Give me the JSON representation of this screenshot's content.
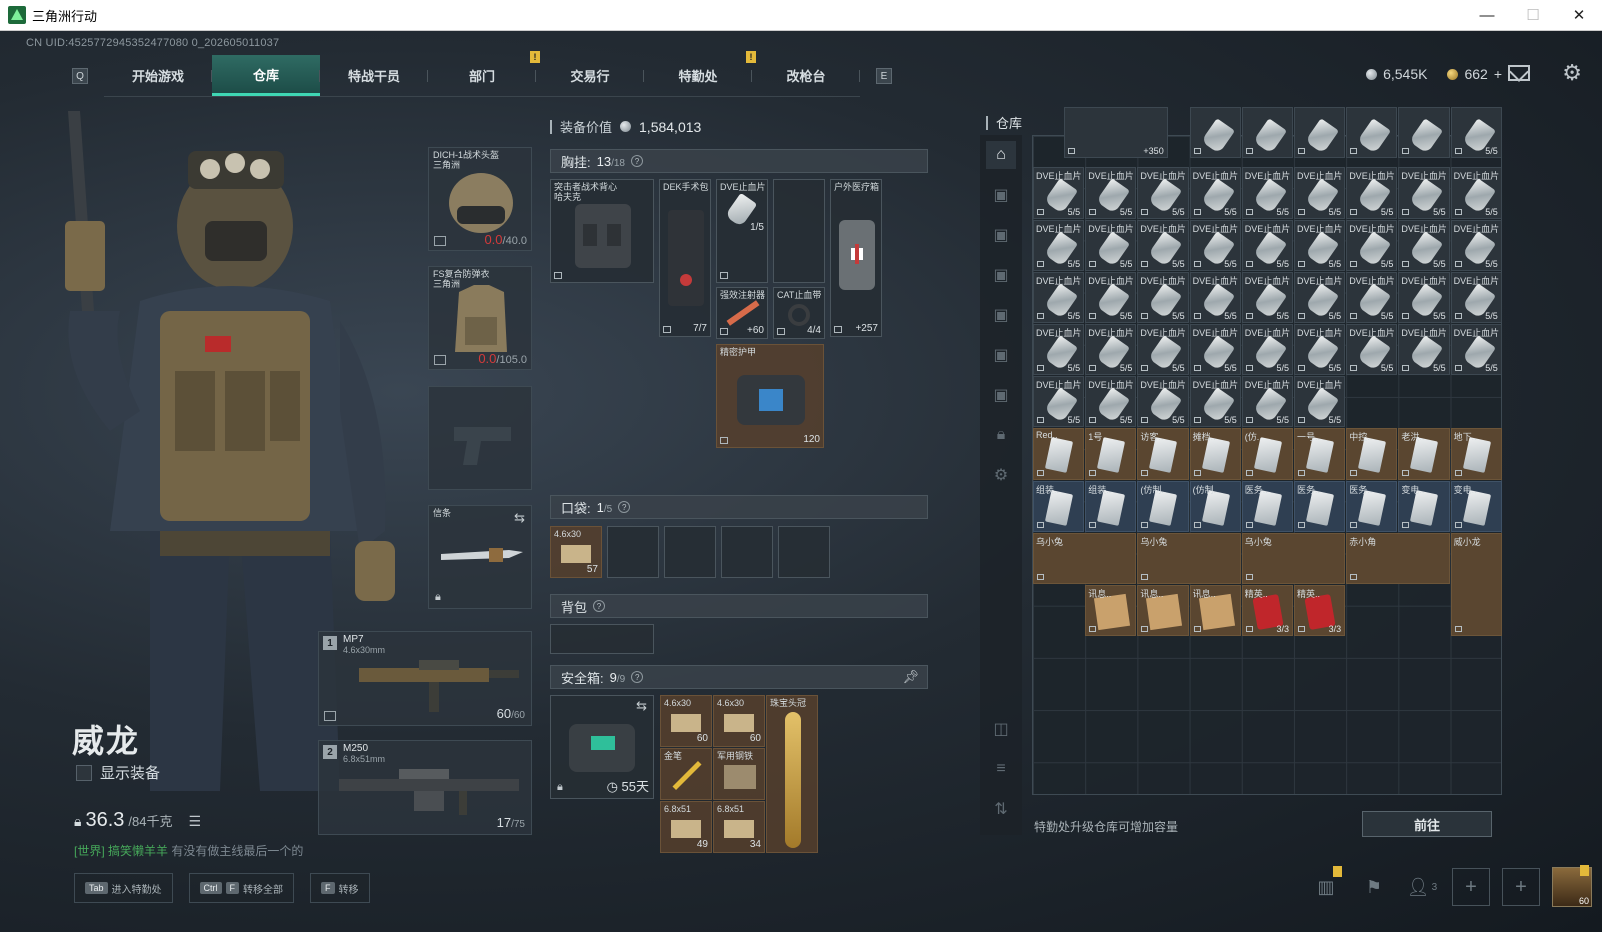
{
  "window": {
    "title": "三角洲行动",
    "minimize": "—",
    "maximize": "☐",
    "close": "✕"
  },
  "uid": "CN UID:4525772945352477080 0_202605011037",
  "nav": {
    "q_key": "Q",
    "e_key": "E",
    "tabs": [
      {
        "label": "开始游戏",
        "active": false
      },
      {
        "label": "仓库",
        "active": true
      },
      {
        "label": "特战干员",
        "active": false
      },
      {
        "label": "部门",
        "active": false
      },
      {
        "label": "交易行",
        "active": false
      },
      {
        "label": "特勤处",
        "active": false
      },
      {
        "label": "改枪台",
        "active": false
      }
    ],
    "badge": "!"
  },
  "currency": {
    "silver": "6,545K",
    "gold": "662",
    "add": "+"
  },
  "operator": {
    "name": "威龙",
    "show_gear": "显示装备",
    "weight_value": "36.3",
    "weight_max": "/84千克",
    "chat_channel": "[世界]",
    "chat_user": "搞笑懒羊羊",
    "chat_text": "有没有做主线最后一个的"
  },
  "gear": {
    "helmet": {
      "label": "DICH-1战术头盔",
      "sub": "三角洲",
      "dur_cur": "0.0",
      "dur_max": "/40.0"
    },
    "armor": {
      "label": "FS复合防弹衣",
      "sub": "三角洲",
      "dur_cur": "0.0",
      "dur_max": "/105.0"
    },
    "melee": {
      "label": "信条"
    },
    "weapon1": {
      "num": "1",
      "name": "MP7",
      "caliber": "4.6x30mm",
      "ammo": "60",
      "ammo_max": "/60"
    },
    "weapon2": {
      "num": "2",
      "name": "M250",
      "caliber": "6.8x51mm",
      "ammo": "17",
      "ammo_max": "/75"
    }
  },
  "middle": {
    "value_label": "装备价值",
    "value_amount": "1,584,013",
    "chest": {
      "label": "胸挂:",
      "cap": "13",
      "cap_max": "/18"
    },
    "chest_items": [
      {
        "label": "突击者战术背心",
        "sub": "哈夫克",
        "count": ""
      },
      {
        "label": "DEK手术包",
        "count": "7/7"
      },
      {
        "label": "DVE止血片",
        "count": "1/5"
      },
      {
        "label": "户外医疗箱",
        "count": "+257"
      },
      {
        "label": "强效注射器",
        "count": "+60"
      },
      {
        "label": "CAT止血带",
        "count": "4/4"
      },
      {
        "label": "精密护甲",
        "count": "120"
      }
    ],
    "pocket": {
      "label": "口袋:",
      "cap": "1",
      "cap_max": "/5"
    },
    "pocket_items": [
      {
        "label": "4.6x30",
        "count": "57"
      }
    ],
    "backpack": {
      "label": "背包"
    },
    "safe": {
      "label": "安全箱:",
      "cap": "9",
      "cap_max": "/9",
      "time": "55天"
    },
    "safe_items": [
      {
        "label": "4.6x30",
        "count": "60"
      },
      {
        "label": "4.6x30",
        "count": "60"
      },
      {
        "label": "珠宝头冠",
        "count": ""
      },
      {
        "label": "金笔",
        "count": ""
      },
      {
        "label": "军用钢铁",
        "count": ""
      },
      {
        "label": "6.8x51",
        "count": "49"
      },
      {
        "label": "6.8x51",
        "count": "34"
      }
    ]
  },
  "stash": {
    "title": "仓库",
    "top_row": [
      {
        "label": "",
        "count": "+350"
      },
      {
        "label": "",
        "count": ""
      },
      {
        "label": "",
        "count": ""
      },
      {
        "label": "",
        "count": ""
      },
      {
        "label": "",
        "count": ""
      },
      {
        "label": "",
        "count": ""
      },
      {
        "label": "",
        "count": "5/5"
      }
    ],
    "dve_label": "DVE止血片",
    "dve_count": "5/5",
    "cards_row1": [
      "Red..",
      "1号..",
      "访客..",
      "摊档..",
      "(仿..",
      "一号..",
      "中控..",
      "老洪..",
      "地下.."
    ],
    "cards_row2": [
      "组装..",
      "组装..",
      "(仿制..",
      "(仿制..",
      "医务..",
      "医务..",
      "医务..",
      "变电..",
      "变电.."
    ],
    "big_items": [
      {
        "label": "乌小兔"
      },
      {
        "label": "乌小兔"
      },
      {
        "label": "乌小兔"
      },
      {
        "label": "赤小角"
      },
      {
        "label": "威小龙"
      }
    ],
    "docs": [
      {
        "label": "讯息..",
        "count": ""
      },
      {
        "label": "讯息..",
        "count": ""
      },
      {
        "label": "讯息..",
        "count": ""
      },
      {
        "label": "精英..",
        "count": "3/3"
      },
      {
        "label": "精英..",
        "count": "3/3"
      }
    ],
    "footer_hint": "特勤处升级仓库可增加容量",
    "goto": "前往"
  },
  "hotkeys": [
    {
      "key": "Tab",
      "key2": "",
      "label": "进入特勤处"
    },
    {
      "key": "Ctrl",
      "key2": "F",
      "label": "转移全部"
    },
    {
      "key": "F",
      "key2": "",
      "label": "转移"
    }
  ],
  "bottom_right": {
    "friends": "3",
    "avatar_level": "60"
  },
  "colors": {
    "accent": "#3fd7b4",
    "durability_low": "#d43a3a",
    "chat_channel": "#46a85a",
    "badge": "#e3b93a"
  }
}
